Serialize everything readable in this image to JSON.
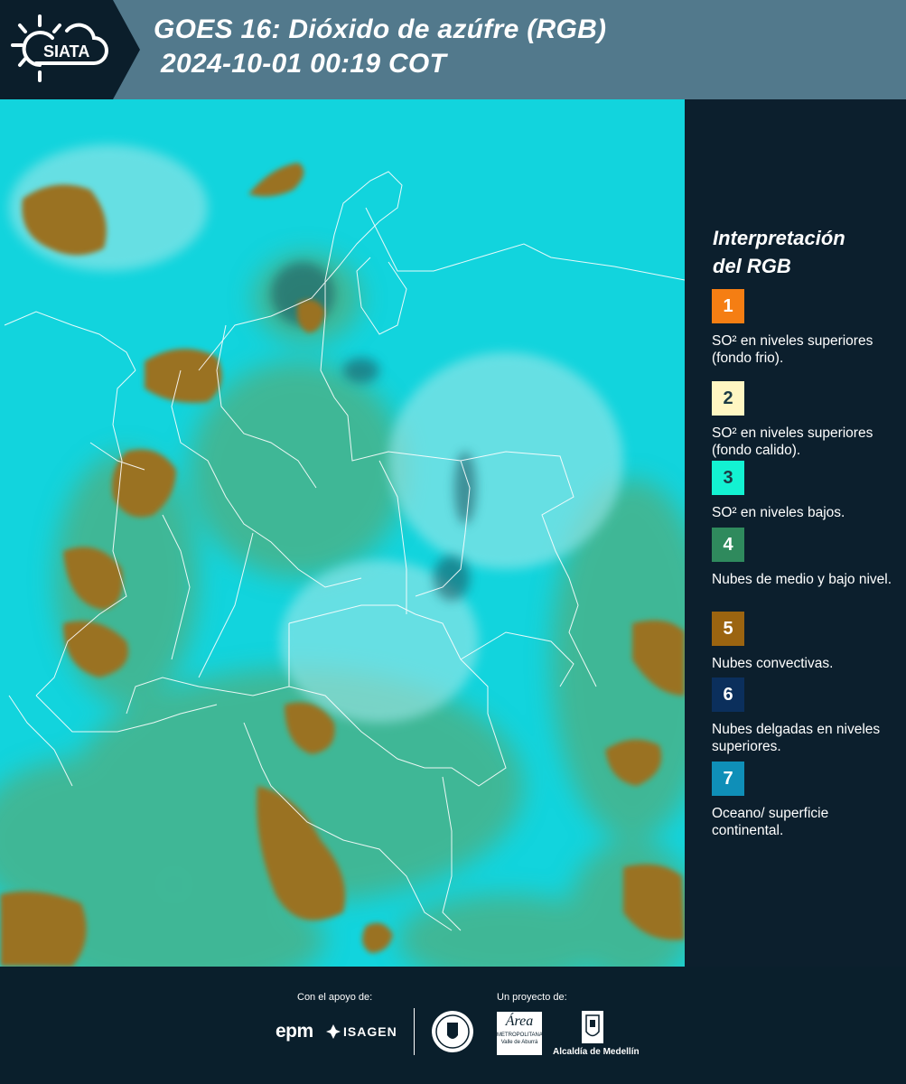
{
  "header": {
    "logo_text": "SIATA",
    "title_line1": "GOES 16: Dióxido de azúfre (RGB)",
    "title_line2": "2024-10-01 00:19 COT"
  },
  "legend": {
    "title_line1": "Interpretación",
    "title_line2": "del RGB",
    "items": [
      {
        "number": "1",
        "color": "#f57e13",
        "label": "SO² en niveles superiores (fondo frio)."
      },
      {
        "number": "2",
        "color": "#fff6c2",
        "label": "SO² en niveles superiores (fondo calido)."
      },
      {
        "number": "3",
        "color": "#13f2d2",
        "label": "SO² en niveles bajos."
      },
      {
        "number": "4",
        "color": "#2f8a5d",
        "label": "Nubes de medio y bajo nivel."
      },
      {
        "number": "5",
        "color": "#9b6410",
        "label": "Nubes convectivas."
      },
      {
        "number": "6",
        "color": "#0b2f5c",
        "label": "Nubes delgadas en niveles superiores."
      },
      {
        "number": "7",
        "color": "#0f8fb8",
        "label": "Oceano/ superficie continental."
      }
    ]
  },
  "footer": {
    "support_caption": "Con el apoyo de:",
    "project_caption": "Un proyecto de:",
    "epm": "epm",
    "isagen": "ISAGEN",
    "area_line1": "Área",
    "area_line2": "METROPOLITANA",
    "area_line3": "Valle de Aburrá",
    "alcaldia": "Alcaldía de Medellín"
  }
}
